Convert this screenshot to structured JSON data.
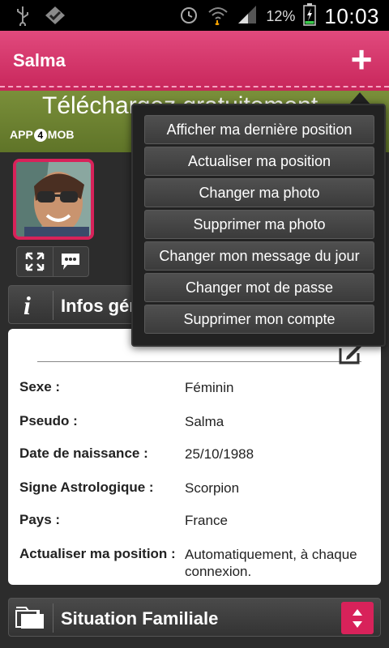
{
  "status_bar": {
    "battery_percent": "12%",
    "time": "10:03"
  },
  "header": {
    "title": "Salma",
    "add_icon": "plus-icon"
  },
  "banner": {
    "text": "Téléchargez gratuitement",
    "logo_prefix": "APP",
    "logo_digit": "4",
    "logo_suffix": "MOB"
  },
  "sections": {
    "general_title": "Infos générales",
    "family_title": "Situation Familiale"
  },
  "info": [
    {
      "label": "Sexe :",
      "value": "Féminin"
    },
    {
      "label": "Pseudo :",
      "value": "Salma"
    },
    {
      "label": "Date de naissance :",
      "value": "25/10/1988"
    },
    {
      "label": "Signe Astrologique :",
      "value": "Scorpion"
    },
    {
      "label": "Pays :",
      "value": "France"
    },
    {
      "label": "Actualiser ma position :",
      "value": "Automatiquement, à chaque connexion."
    }
  ],
  "menu": {
    "items": [
      "Afficher ma dernière position",
      "Actualiser ma position",
      "Changer ma photo",
      "Supprimer ma photo",
      "Changer mon message du jour",
      "Changer mot de passe",
      "Supprimer mon compte"
    ]
  },
  "colors": {
    "accent": "#d8225a",
    "header": "#e14a7d",
    "banner": "#6f842f"
  }
}
